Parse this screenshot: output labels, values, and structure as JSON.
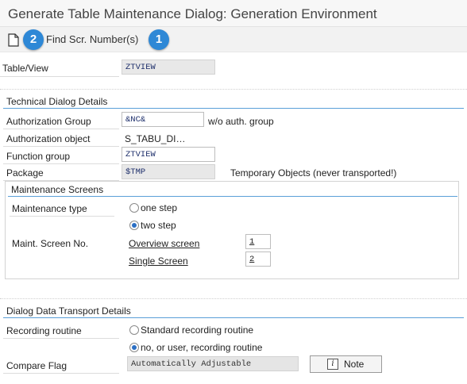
{
  "window": {
    "title": "Generate Table Maintenance Dialog: Generation Environment"
  },
  "toolbar": {
    "badge_left": "2",
    "find_label": "Find Scr. Number(s)",
    "badge_right": "1"
  },
  "table_view": {
    "label": "Table/View",
    "value": "ZTVIEW"
  },
  "technical": {
    "heading": "Technical Dialog Details",
    "auth_group_label": "Authorization Group",
    "auth_group_value": "&NC&",
    "auth_group_desc": "w/o auth. group",
    "auth_object_label": "Authorization object",
    "auth_object_value": "S_TABU_DI…",
    "function_group_label": "Function group",
    "function_group_value": "ZTVIEW",
    "package_label": "Package",
    "package_value": "$TMP",
    "package_desc": "Temporary Objects (never transported!)"
  },
  "maintenance": {
    "heading": "Maintenance Screens",
    "type_label": "Maintenance type",
    "one_step": "one step",
    "two_step": "two step",
    "selected_type": "two step",
    "screen_no_label": "Maint. Screen No.",
    "overview_label": "Overview screen",
    "overview_value": "1",
    "single_label": "Single Screen",
    "single_value": "2"
  },
  "transport": {
    "heading": "Dialog Data Transport Details",
    "recording_label": "Recording routine",
    "standard_routine": "Standard recording routine",
    "user_routine": "no, or user, recording routine",
    "selected_routine": "no, or user, recording routine",
    "compare_label": "Compare Flag",
    "compare_value": "Automatically Adjustable",
    "note_button": "Note"
  },
  "colors": {
    "accent": "#2e88d6",
    "section_line": "#5a9fd8",
    "radio_on": "#2b6fc4"
  }
}
